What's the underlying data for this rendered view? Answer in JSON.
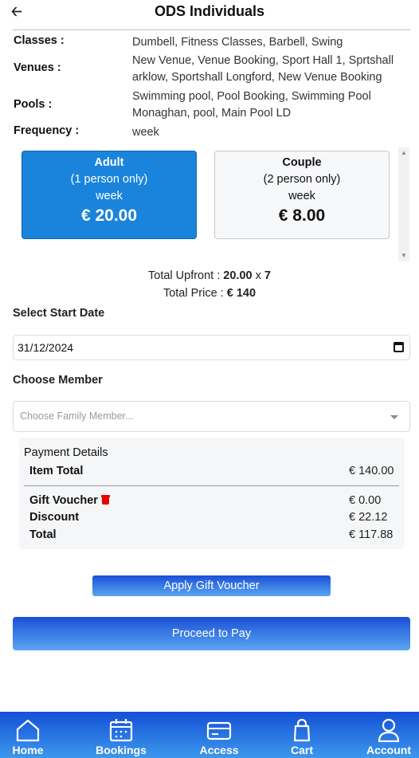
{
  "header": {
    "title": "ODS Individuals"
  },
  "info": {
    "classes_label": "Classes :",
    "classes_value": "Dumbell, Fitness Classes, Barbell, Swing",
    "venues_label": "Venues :",
    "venues_value": "New Venue, Venue Booking, Sport Hall 1, Sprtshall arklow, Sportshall Longford, New Venue Booking",
    "pools_label": "Pools :",
    "pools_value": "Swimming pool, Pool Booking, Swimming Pool Monaghan, pool, Main Pool LD",
    "frequency_label": "Frequency :",
    "frequency_value": "week"
  },
  "plans": [
    {
      "name": "Adult",
      "desc": "(1 person only)",
      "period": "week",
      "price": "€ 20.00",
      "selected": true
    },
    {
      "name": "Couple",
      "desc": "(2 person only)",
      "period": "week",
      "price": "€ 8.00",
      "selected": false
    }
  ],
  "totals": {
    "upfront_label": "Total Upfront :",
    "upfront_amount": "20.00",
    "times": "x",
    "multiplier": "7",
    "price_label": "Total Price :",
    "price_value": "€ 140"
  },
  "start_date": {
    "label": "Select Start Date",
    "value": "31/12/2024"
  },
  "member": {
    "label": "Choose Member",
    "placeholder": "Choose Family Member..."
  },
  "payment": {
    "title": "Payment Details",
    "item_total_label": "Item Total",
    "item_total_value": "€ 140.00",
    "gift_voucher_label": "Gift Voucher",
    "gift_voucher_value": "€ 0.00",
    "discount_label": "Discount",
    "discount_value": "€ 22.12",
    "total_label": "Total",
    "total_value": "€ 117.88"
  },
  "buttons": {
    "apply_gift": "Apply Gift Voucher",
    "proceed": "Proceed to Pay"
  },
  "nav": [
    {
      "label": "Home",
      "icon": "home-icon"
    },
    {
      "label": "Bookings",
      "icon": "calendar-icon"
    },
    {
      "label": "Access",
      "icon": "card-icon"
    },
    {
      "label": "Cart",
      "icon": "bag-icon"
    },
    {
      "label": "Account",
      "icon": "user-icon"
    }
  ],
  "colors": {
    "accent": "#1a84dc",
    "nav_gradient_top": "#1450d6",
    "nav_gradient_bottom": "#3c98ec",
    "danger": "#e00000"
  }
}
